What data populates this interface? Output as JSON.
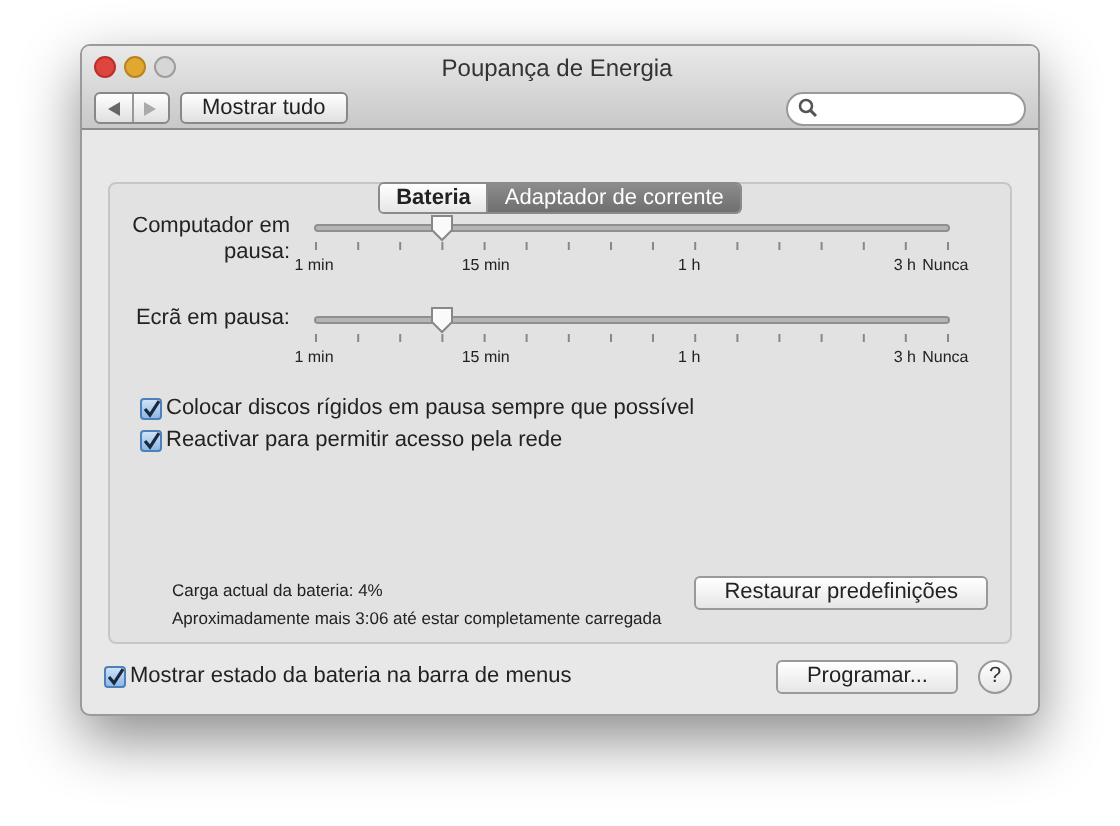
{
  "window": {
    "title": "Poupança de Energia"
  },
  "toolbar": {
    "show_all": "Mostrar tudo"
  },
  "tabs": [
    {
      "label": "Bateria",
      "selected": false
    },
    {
      "label": "Adaptador de corrente",
      "selected": true
    }
  ],
  "sliders": [
    {
      "label": "Computador em pausa:",
      "level": 0.2,
      "ticks": [
        "1 min",
        "15 min",
        "1 h",
        "3 h",
        "Nunca"
      ]
    },
    {
      "label": "Ecrã em pausa:",
      "level": 0.2,
      "ticks": [
        "1 min",
        "15 min",
        "1 h",
        "3 h",
        "Nunca"
      ]
    }
  ],
  "options": [
    {
      "label": "Colocar discos rígidos em pausa sempre que possível",
      "checked": true
    },
    {
      "label": "Reactivar para permitir acesso pela rede",
      "checked": true
    }
  ],
  "battery_info": [
    "Carga actual da bateria: 4%",
    "Aproximadamente mais 3:06 até estar completamente carregada"
  ],
  "restore_button": "Restaurar predefinições",
  "show_status": {
    "label": "Mostrar estado da bateria na barra de menus",
    "checked": true
  },
  "schedule_button": "Programar...",
  "help_button": "?"
}
